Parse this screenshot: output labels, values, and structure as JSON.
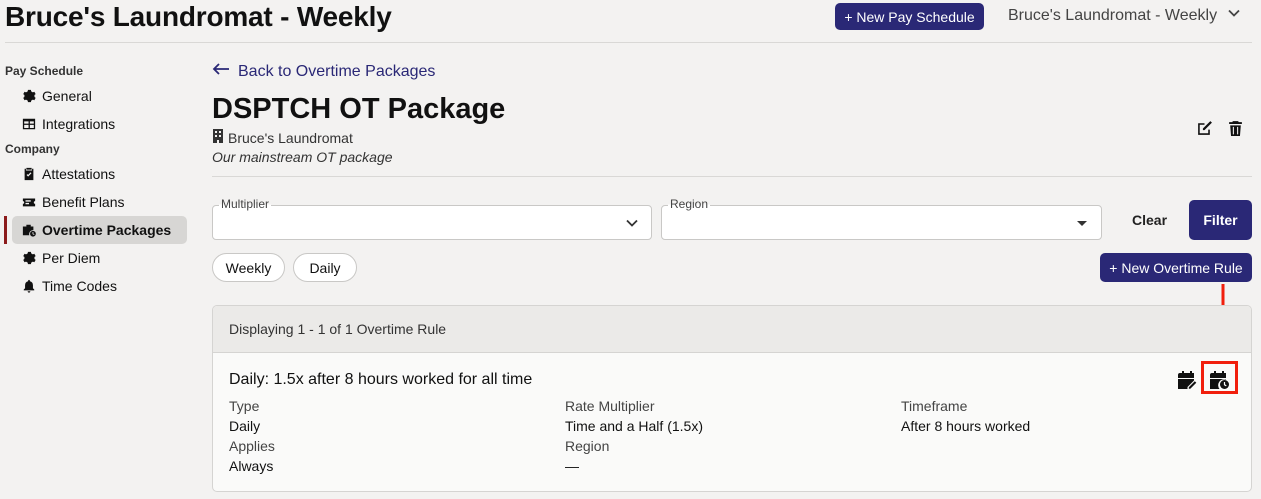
{
  "header": {
    "app_title": "Bruce's Laundromat - Weekly",
    "new_pay_schedule_label": "+ New Pay Schedule",
    "schedule_selector": "Bruce's Laundromat - Weekly"
  },
  "sidebar": {
    "sections": [
      {
        "title": "Pay Schedule",
        "items": [
          {
            "label": "General",
            "icon": "gear-icon"
          },
          {
            "label": "Integrations",
            "icon": "table-icon"
          }
        ]
      },
      {
        "title": "Company",
        "items": [
          {
            "label": "Attestations",
            "icon": "clipboard-check-icon"
          },
          {
            "label": "Benefit Plans",
            "icon": "ticket-icon"
          },
          {
            "label": "Overtime Packages",
            "icon": "clock-briefcase-icon",
            "active": true
          },
          {
            "label": "Per Diem",
            "icon": "gear-icon"
          },
          {
            "label": "Time Codes",
            "icon": "bell-icon"
          }
        ]
      }
    ]
  },
  "main": {
    "back_label": "Back to Overtime Packages",
    "title": "DSPTCH OT Package",
    "company": "Bruce's Laundromat",
    "description": "Our mainstream OT package",
    "filters": {
      "multiplier_label": "Multiplier",
      "multiplier_value": "",
      "region_label": "Region",
      "region_value": "",
      "clear_label": "Clear",
      "filter_label": "Filter"
    },
    "chips": [
      "Weekly",
      "Daily"
    ],
    "new_rule_label": "+ New Overtime Rule",
    "list": {
      "displaying": "Displaying 1 - 1 of 1 Overtime Rule",
      "rule": {
        "title": "Daily: 1.5x after 8 hours worked for all time",
        "type_label": "Type",
        "type_value": "Daily",
        "rate_label": "Rate Multiplier",
        "rate_value": "Time and a Half (1.5x)",
        "timeframe_label": "Timeframe",
        "timeframe_value": "After 8 hours worked",
        "applies_label": "Applies",
        "applies_value": "Always",
        "region_label": "Region",
        "region_value": "—"
      }
    }
  },
  "colors": {
    "primary": "#2a2876",
    "accent_bar": "#8c1c1c",
    "highlight": "#f11f0d",
    "background": "#f3f2f1"
  }
}
